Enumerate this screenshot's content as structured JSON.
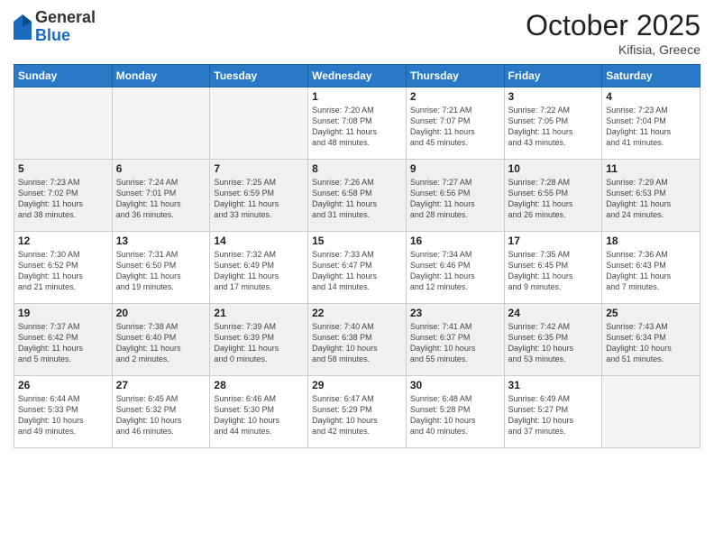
{
  "logo": {
    "general": "General",
    "blue": "Blue"
  },
  "header": {
    "month": "October 2025",
    "location": "Kifisia, Greece"
  },
  "weekdays": [
    "Sunday",
    "Monday",
    "Tuesday",
    "Wednesday",
    "Thursday",
    "Friday",
    "Saturday"
  ],
  "weeks": [
    [
      {
        "day": "",
        "info": ""
      },
      {
        "day": "",
        "info": ""
      },
      {
        "day": "",
        "info": ""
      },
      {
        "day": "1",
        "info": "Sunrise: 7:20 AM\nSunset: 7:08 PM\nDaylight: 11 hours\nand 48 minutes."
      },
      {
        "day": "2",
        "info": "Sunrise: 7:21 AM\nSunset: 7:07 PM\nDaylight: 11 hours\nand 45 minutes."
      },
      {
        "day": "3",
        "info": "Sunrise: 7:22 AM\nSunset: 7:05 PM\nDaylight: 11 hours\nand 43 minutes."
      },
      {
        "day": "4",
        "info": "Sunrise: 7:23 AM\nSunset: 7:04 PM\nDaylight: 11 hours\nand 41 minutes."
      }
    ],
    [
      {
        "day": "5",
        "info": "Sunrise: 7:23 AM\nSunset: 7:02 PM\nDaylight: 11 hours\nand 38 minutes."
      },
      {
        "day": "6",
        "info": "Sunrise: 7:24 AM\nSunset: 7:01 PM\nDaylight: 11 hours\nand 36 minutes."
      },
      {
        "day": "7",
        "info": "Sunrise: 7:25 AM\nSunset: 6:59 PM\nDaylight: 11 hours\nand 33 minutes."
      },
      {
        "day": "8",
        "info": "Sunrise: 7:26 AM\nSunset: 6:58 PM\nDaylight: 11 hours\nand 31 minutes."
      },
      {
        "day": "9",
        "info": "Sunrise: 7:27 AM\nSunset: 6:56 PM\nDaylight: 11 hours\nand 28 minutes."
      },
      {
        "day": "10",
        "info": "Sunrise: 7:28 AM\nSunset: 6:55 PM\nDaylight: 11 hours\nand 26 minutes."
      },
      {
        "day": "11",
        "info": "Sunrise: 7:29 AM\nSunset: 6:53 PM\nDaylight: 11 hours\nand 24 minutes."
      }
    ],
    [
      {
        "day": "12",
        "info": "Sunrise: 7:30 AM\nSunset: 6:52 PM\nDaylight: 11 hours\nand 21 minutes."
      },
      {
        "day": "13",
        "info": "Sunrise: 7:31 AM\nSunset: 6:50 PM\nDaylight: 11 hours\nand 19 minutes."
      },
      {
        "day": "14",
        "info": "Sunrise: 7:32 AM\nSunset: 6:49 PM\nDaylight: 11 hours\nand 17 minutes."
      },
      {
        "day": "15",
        "info": "Sunrise: 7:33 AM\nSunset: 6:47 PM\nDaylight: 11 hours\nand 14 minutes."
      },
      {
        "day": "16",
        "info": "Sunrise: 7:34 AM\nSunset: 6:46 PM\nDaylight: 11 hours\nand 12 minutes."
      },
      {
        "day": "17",
        "info": "Sunrise: 7:35 AM\nSunset: 6:45 PM\nDaylight: 11 hours\nand 9 minutes."
      },
      {
        "day": "18",
        "info": "Sunrise: 7:36 AM\nSunset: 6:43 PM\nDaylight: 11 hours\nand 7 minutes."
      }
    ],
    [
      {
        "day": "19",
        "info": "Sunrise: 7:37 AM\nSunset: 6:42 PM\nDaylight: 11 hours\nand 5 minutes."
      },
      {
        "day": "20",
        "info": "Sunrise: 7:38 AM\nSunset: 6:40 PM\nDaylight: 11 hours\nand 2 minutes."
      },
      {
        "day": "21",
        "info": "Sunrise: 7:39 AM\nSunset: 6:39 PM\nDaylight: 11 hours\nand 0 minutes."
      },
      {
        "day": "22",
        "info": "Sunrise: 7:40 AM\nSunset: 6:38 PM\nDaylight: 10 hours\nand 58 minutes."
      },
      {
        "day": "23",
        "info": "Sunrise: 7:41 AM\nSunset: 6:37 PM\nDaylight: 10 hours\nand 55 minutes."
      },
      {
        "day": "24",
        "info": "Sunrise: 7:42 AM\nSunset: 6:35 PM\nDaylight: 10 hours\nand 53 minutes."
      },
      {
        "day": "25",
        "info": "Sunrise: 7:43 AM\nSunset: 6:34 PM\nDaylight: 10 hours\nand 51 minutes."
      }
    ],
    [
      {
        "day": "26",
        "info": "Sunrise: 6:44 AM\nSunset: 5:33 PM\nDaylight: 10 hours\nand 49 minutes."
      },
      {
        "day": "27",
        "info": "Sunrise: 6:45 AM\nSunset: 5:32 PM\nDaylight: 10 hours\nand 46 minutes."
      },
      {
        "day": "28",
        "info": "Sunrise: 6:46 AM\nSunset: 5:30 PM\nDaylight: 10 hours\nand 44 minutes."
      },
      {
        "day": "29",
        "info": "Sunrise: 6:47 AM\nSunset: 5:29 PM\nDaylight: 10 hours\nand 42 minutes."
      },
      {
        "day": "30",
        "info": "Sunrise: 6:48 AM\nSunset: 5:28 PM\nDaylight: 10 hours\nand 40 minutes."
      },
      {
        "day": "31",
        "info": "Sunrise: 6:49 AM\nSunset: 5:27 PM\nDaylight: 10 hours\nand 37 minutes."
      },
      {
        "day": "",
        "info": ""
      }
    ]
  ]
}
